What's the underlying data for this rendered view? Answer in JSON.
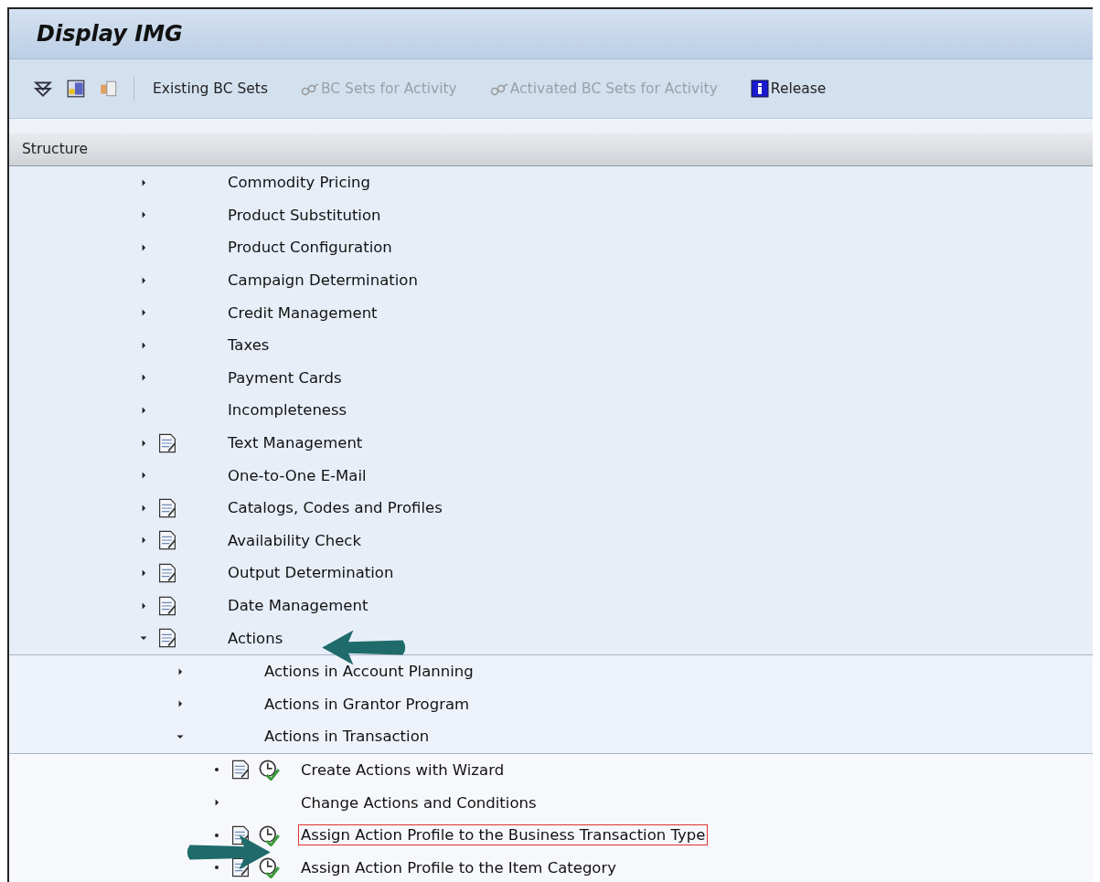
{
  "window": {
    "title": "Display IMG"
  },
  "toolbar": {
    "items": [
      {
        "kind": "icon"
      },
      {
        "kind": "icon"
      },
      {
        "kind": "icon"
      },
      {
        "kind": "separator"
      },
      {
        "kind": "text",
        "label": "Existing BC Sets",
        "disabled": false
      },
      {
        "kind": "glasses",
        "label": "BC Sets for Activity",
        "disabled": true
      },
      {
        "kind": "glasses",
        "label": "Activated BC Sets for Activity",
        "disabled": true
      },
      {
        "kind": "info",
        "label": "Release",
        "disabled": false
      }
    ]
  },
  "structure": {
    "header": "Structure",
    "nodes": [
      {
        "label": "Commodity Pricing",
        "doc": false,
        "activity": false,
        "expanded": false,
        "leaf": false
      },
      {
        "label": "Product Substitution",
        "doc": false,
        "activity": false,
        "expanded": false,
        "leaf": false
      },
      {
        "label": "Product Configuration",
        "doc": false,
        "activity": false,
        "expanded": false,
        "leaf": false
      },
      {
        "label": "Campaign Determination",
        "doc": false,
        "activity": false,
        "expanded": false,
        "leaf": false
      },
      {
        "label": "Credit Management",
        "doc": false,
        "activity": false,
        "expanded": false,
        "leaf": false
      },
      {
        "label": "Taxes",
        "doc": false,
        "activity": false,
        "expanded": false,
        "leaf": false
      },
      {
        "label": "Payment Cards",
        "doc": false,
        "activity": false,
        "expanded": false,
        "leaf": false
      },
      {
        "label": "Incompleteness",
        "doc": false,
        "activity": false,
        "expanded": false,
        "leaf": false
      },
      {
        "label": "Text Management",
        "doc": true,
        "activity": false,
        "expanded": false,
        "leaf": false
      },
      {
        "label": "One-to-One E-Mail",
        "doc": false,
        "activity": false,
        "expanded": false,
        "leaf": false
      },
      {
        "label": "Catalogs, Codes and Profiles",
        "doc": true,
        "activity": false,
        "expanded": false,
        "leaf": false
      },
      {
        "label": "Availability Check",
        "doc": true,
        "activity": false,
        "expanded": false,
        "leaf": false
      },
      {
        "label": "Output Determination",
        "doc": true,
        "activity": false,
        "expanded": false,
        "leaf": false
      },
      {
        "label": "Date Management",
        "doc": true,
        "activity": false,
        "expanded": false,
        "leaf": false
      },
      {
        "label": "Actions",
        "doc": true,
        "activity": false,
        "expanded": true,
        "leaf": false,
        "children": [
          {
            "label": "Actions in Account Planning",
            "doc": false,
            "activity": false,
            "expanded": false,
            "leaf": false
          },
          {
            "label": "Actions in Grantor Program",
            "doc": false,
            "activity": false,
            "expanded": false,
            "leaf": false
          },
          {
            "label": "Actions in Transaction",
            "doc": false,
            "activity": false,
            "expanded": true,
            "leaf": false,
            "children": [
              {
                "label": "Create Actions with Wizard",
                "doc": true,
                "activity": true,
                "expanded": false,
                "leaf": true,
                "selected": false
              },
              {
                "label": "Change Actions and Conditions",
                "doc": false,
                "activity": false,
                "expanded": false,
                "leaf": false,
                "selected": false
              },
              {
                "label": "Assign Action Profile to the Business Transaction Type",
                "doc": true,
                "activity": true,
                "expanded": false,
                "leaf": true,
                "selected": true
              },
              {
                "label": "Assign Action Profile to the Item Category",
                "doc": true,
                "activity": true,
                "expanded": false,
                "leaf": true,
                "selected": false
              }
            ]
          }
        ]
      }
    ]
  }
}
